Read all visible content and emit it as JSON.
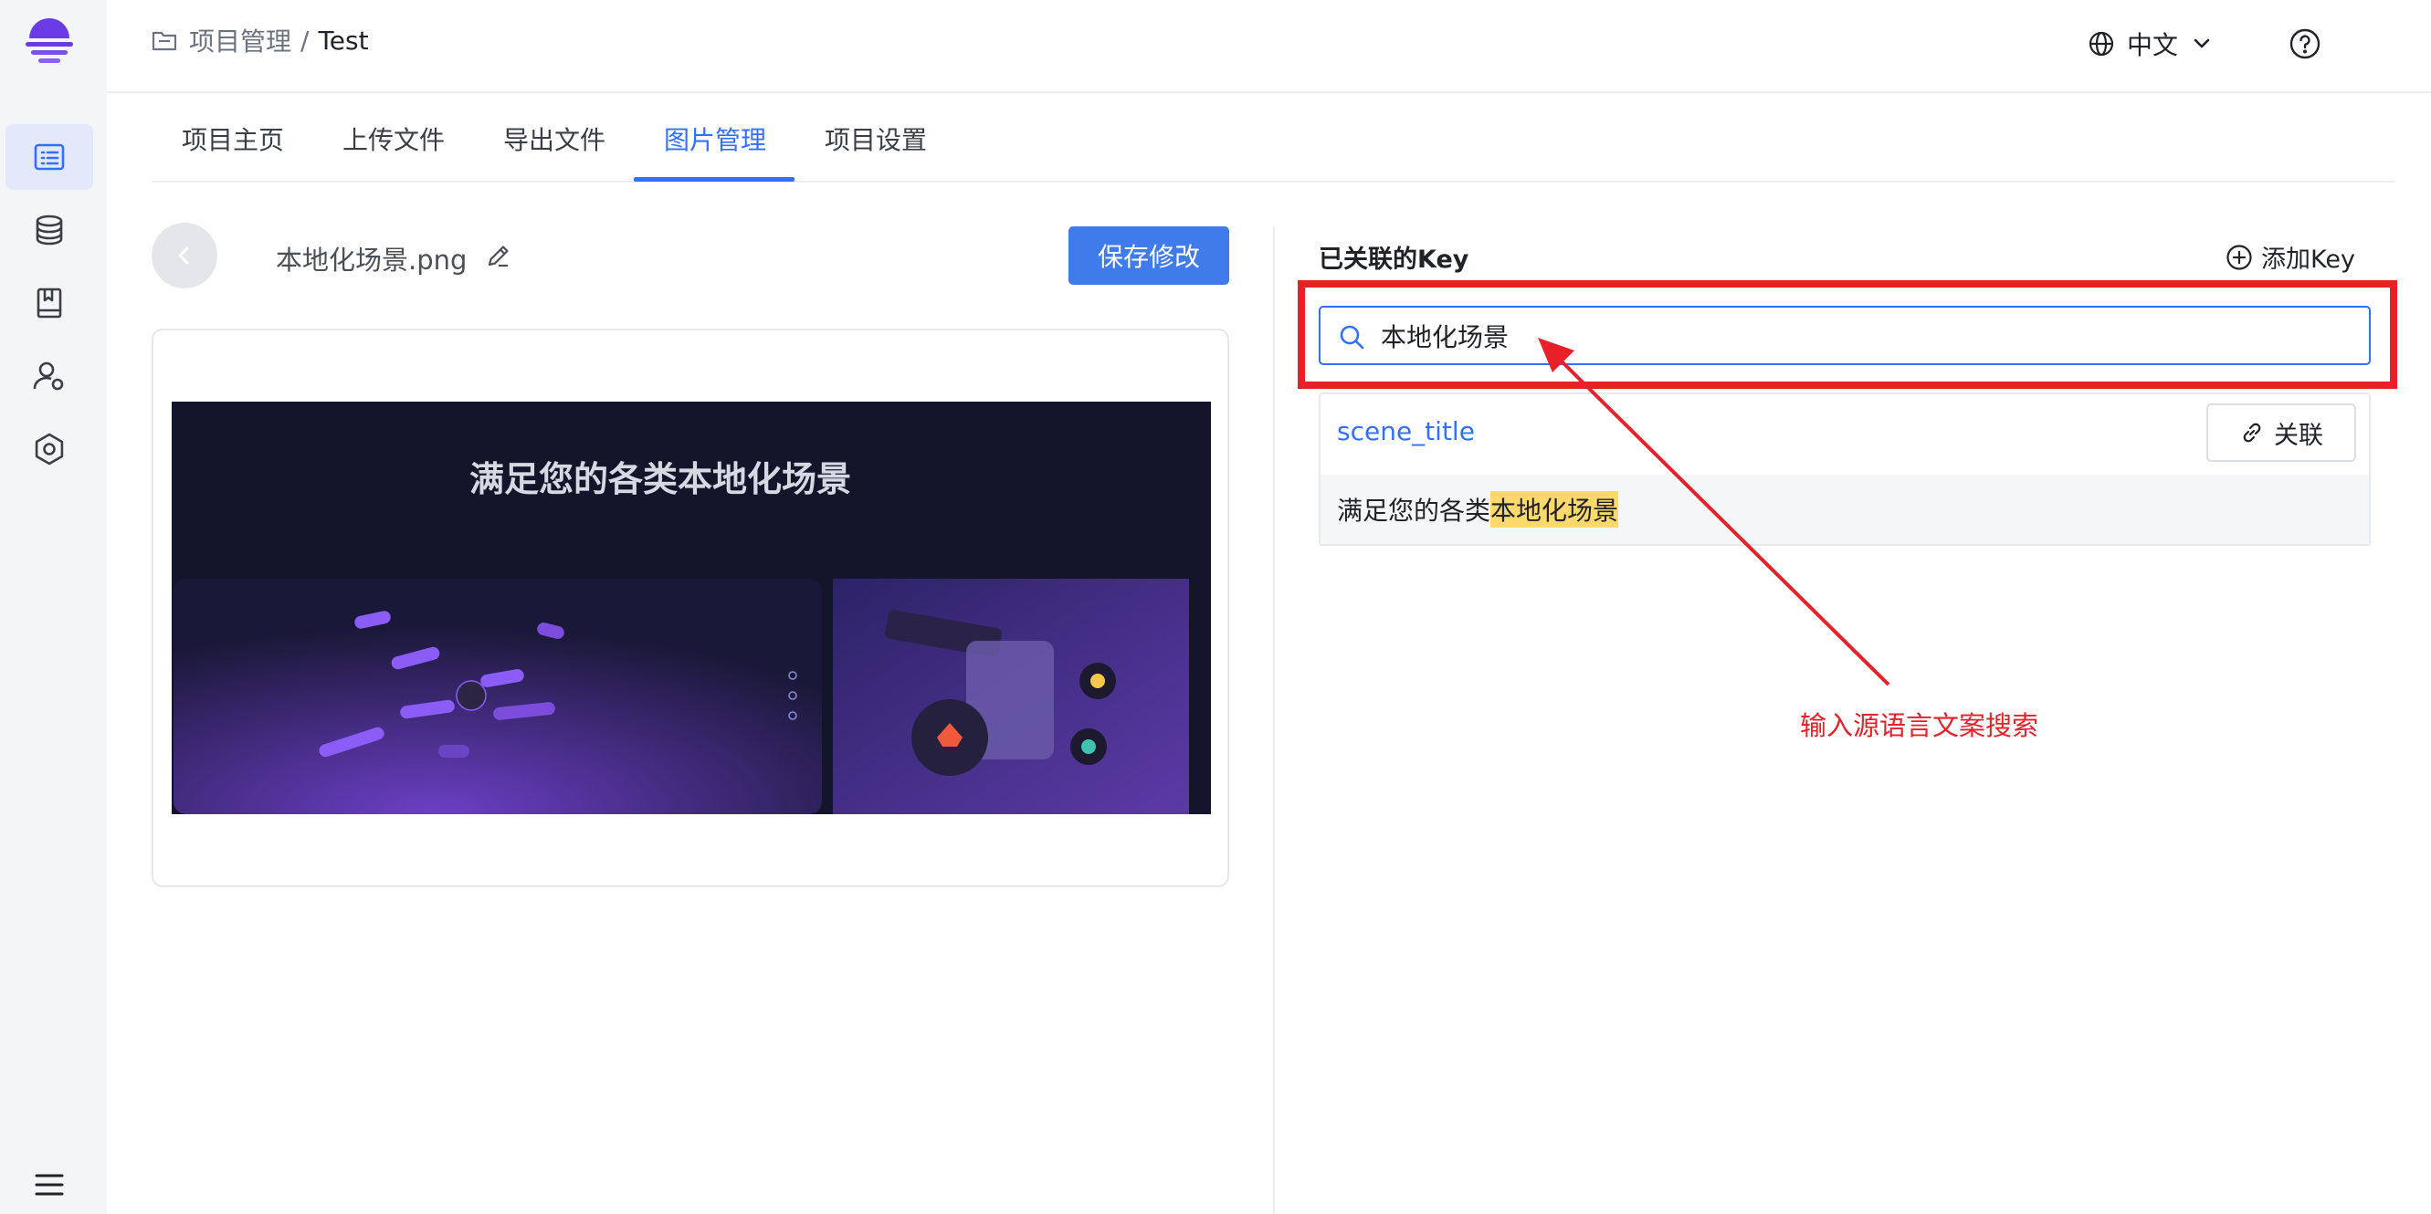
{
  "breadcrumb": {
    "parent": "项目管理",
    "separator": "/",
    "current": "Test"
  },
  "header": {
    "language": "中文"
  },
  "tabs": [
    {
      "label": "项目主页",
      "active": false
    },
    {
      "label": "上传文件",
      "active": false
    },
    {
      "label": "导出文件",
      "active": false
    },
    {
      "label": "图片管理",
      "active": true
    },
    {
      "label": "项目设置",
      "active": false
    }
  ],
  "left_panel": {
    "file_name": "本地化场景.png",
    "save_label": "保存修改",
    "preview_title": "满足您的各类本地化场景"
  },
  "right_panel": {
    "title": "已关联的Key",
    "add_key_label": "添加Key",
    "search_value": "本地化场景",
    "result": {
      "key": "scene_title",
      "link_label": "关联",
      "text_prefix": "满足您的各类",
      "text_highlight": "本地化场景"
    }
  },
  "annotation": "输入源语言文案搜索",
  "colors": {
    "accent": "#3370ff",
    "annotation_red": "#e8202a",
    "highlight": "#fdd86a",
    "save_button": "#3f7bea"
  }
}
